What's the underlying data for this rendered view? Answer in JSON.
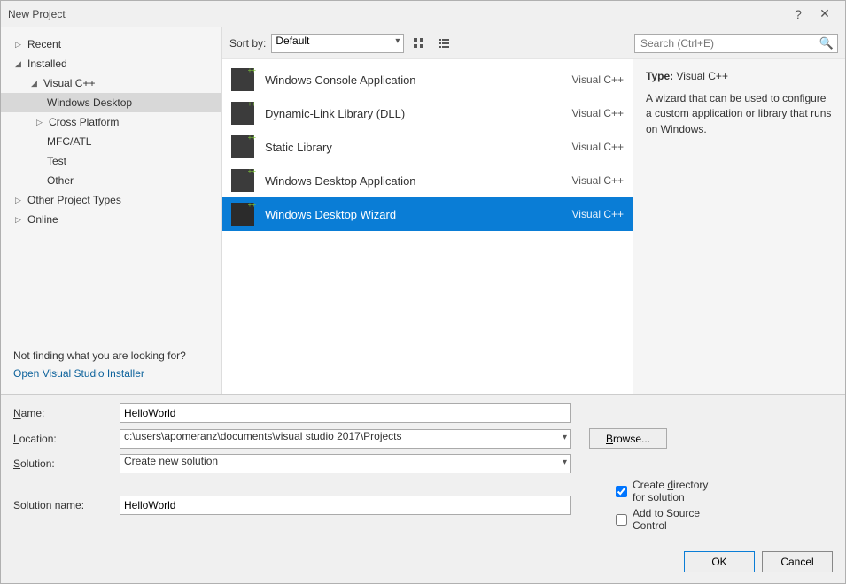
{
  "title": "New Project",
  "sidebar": {
    "recent": "Recent",
    "installed": "Installed",
    "vcpp": "Visual C++",
    "vcpp_children": {
      "desktop": "Windows Desktop",
      "cross": "Cross Platform",
      "mfc": "MFC/ATL",
      "test": "Test",
      "other": "Other"
    },
    "other_types": "Other Project Types",
    "online": "Online",
    "not_finding": "Not finding what you are looking for?",
    "installer_link": "Open Visual Studio Installer"
  },
  "toolbar": {
    "sort_label": "Sort by:",
    "sort_value": "Default",
    "search_placeholder": "Search (Ctrl+E)"
  },
  "templates": [
    {
      "label": "Windows Console Application",
      "lang": "Visual C++",
      "selected": false
    },
    {
      "label": "Dynamic-Link Library (DLL)",
      "lang": "Visual C++",
      "selected": false
    },
    {
      "label": "Static Library",
      "lang": "Visual C++",
      "selected": false
    },
    {
      "label": "Windows Desktop Application",
      "lang": "Visual C++",
      "selected": false
    },
    {
      "label": "Windows Desktop Wizard",
      "lang": "Visual C++",
      "selected": true
    }
  ],
  "description": {
    "type_label": "Type:",
    "type_value": "Visual C++",
    "text": "A wizard that can be used to configure a custom application or library that runs on Windows."
  },
  "form": {
    "name_label": "Name:",
    "name_value": "HelloWorld",
    "location_label": "Location:",
    "location_value": "c:\\users\\apomeranz\\documents\\visual studio 2017\\Projects",
    "browse": "Browse...",
    "solution_label": "Solution:",
    "solution_value": "Create new solution",
    "solname_label": "Solution name:",
    "solname_value": "HelloWorld",
    "create_dir": "Create directory for solution",
    "create_dir_checked": true,
    "source_control": "Add to Source Control",
    "source_control_checked": false
  },
  "buttons": {
    "ok": "OK",
    "cancel": "Cancel"
  }
}
